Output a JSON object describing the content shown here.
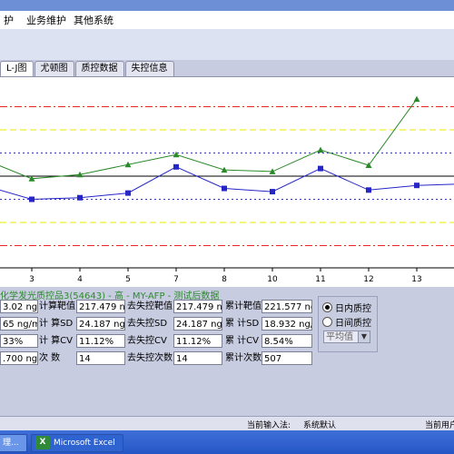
{
  "menu": {
    "items": [
      "护",
      "业务维护",
      "其他系统"
    ]
  },
  "tabs": [
    {
      "label": "L-J图",
      "active": true
    },
    {
      "label": "尤顿图",
      "active": false
    },
    {
      "label": "质控数据",
      "active": false
    },
    {
      "label": "失控信息",
      "active": false
    }
  ],
  "chart_data": {
    "type": "line",
    "x_tick_labels": [
      "3",
      "4",
      "5",
      "7",
      "8",
      "10",
      "11",
      "12",
      "13"
    ],
    "series": [
      {
        "color": "#2a8a2a",
        "marker": "triangle",
        "values_sd": [
          0.73,
          -0.11,
          0.07,
          0.5,
          0.93,
          0.27,
          0.2,
          1.13,
          0.47,
          3.33
        ]
      },
      {
        "color": "#2525c8",
        "marker": "square",
        "values_sd": [
          -0.4,
          -1.0,
          -0.93,
          -0.73,
          0.4,
          -0.53,
          -0.67,
          0.33,
          -0.6,
          -0.4,
          -0.33
        ]
      }
    ],
    "reference_lines_sd": [
      {
        "sd": 0,
        "color": "#000000",
        "style": "solid"
      },
      {
        "sd": 1,
        "color": "#3333cc",
        "style": "dotted"
      },
      {
        "sd": -1,
        "color": "#3333cc",
        "style": "dotted"
      },
      {
        "sd": 2,
        "color": "#e8e800",
        "style": "dashed"
      },
      {
        "sd": -2,
        "color": "#e8e800",
        "style": "dashed"
      },
      {
        "sd": 3,
        "color": "#ee2222",
        "style": "dashdot"
      },
      {
        "sd": -3,
        "color": "#ee2222",
        "style": "dashdot"
      }
    ],
    "grid": false
  },
  "info": {
    "sample_title": "化学发光质控品3(54643) - 高 - MY-AFP - 测试后数据",
    "col1": [
      "3.02 ng/",
      "65 ng/ml",
      "33%",
      ".700 ng/"
    ],
    "col2_labels": [
      "计算靶值",
      "计 算SD",
      "计 算CV",
      "次    数"
    ],
    "col2_values": [
      "217.479 ng",
      "24.187 ng/",
      "11.12%",
      "14"
    ],
    "col3_labels": [
      "去失控靶值",
      "去失控SD",
      "去失控CV",
      "去失控次数"
    ],
    "col3_values": [
      "217.479 ng",
      "24.187 ng/",
      "11.12%",
      "14"
    ],
    "col4_labels": [
      "累计靶值",
      "累 计SD",
      "累 计CV",
      "累计次数"
    ],
    "col4_values": [
      "221.577 ng",
      "18.932 ng/",
      "8.54%",
      "507"
    ],
    "radio_options": [
      {
        "label": "日内质控",
        "selected": true
      },
      {
        "label": "日间质控",
        "selected": false
      }
    ],
    "dropdown_value": "平均值"
  },
  "status": {
    "input_method_label": "当前输入法:",
    "input_method_value": "系统默认",
    "current_user_label": "当前用户"
  },
  "taskbar": {
    "item1_label": "理...",
    "excel_label": "Microsoft Excel"
  }
}
